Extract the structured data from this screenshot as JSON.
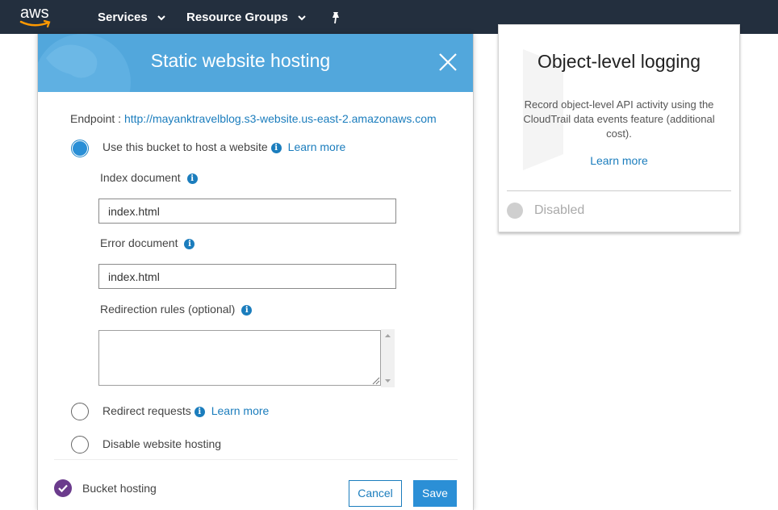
{
  "nav": {
    "logo_text": "aws",
    "services_label": "Services",
    "resource_groups_label": "Resource Groups"
  },
  "logging_card": {
    "title": "Object-level logging",
    "description": "Record object-level API activity using the CloudTrail data events feature (additional cost).",
    "learn_more": "Learn more",
    "status": "Disabled"
  },
  "modal": {
    "title": "Static website hosting",
    "endpoint_label": "Endpoint :",
    "endpoint_url": "http://mayanktravelblog.s3-website.us-east-2.amazonaws.com",
    "options": [
      {
        "label": "Use this bucket to host a website",
        "learn_more": "Learn more",
        "selected": true
      },
      {
        "label": "Redirect requests",
        "learn_more": "Learn more",
        "selected": false
      },
      {
        "label": "Disable website hosting",
        "selected": false
      }
    ],
    "index_document_label": "Index document",
    "index_document_value": "index.html",
    "error_document_label": "Error document",
    "error_document_value": "index.html",
    "redirection_rules_label": "Redirection rules (optional)",
    "redirection_rules_value": "",
    "footer_label": "Bucket hosting",
    "cancel_label": "Cancel",
    "save_label": "Save"
  },
  "colors": {
    "nav_bg": "#232f3e",
    "header_bg": "#52a7dc",
    "link": "#1b7dbd",
    "primary_button": "#2b8fd6",
    "check": "#6b3b8c"
  },
  "icons": [
    "aws-logo",
    "chevron-down-icon",
    "pin-icon",
    "close-icon",
    "info-icon",
    "check-icon"
  ]
}
